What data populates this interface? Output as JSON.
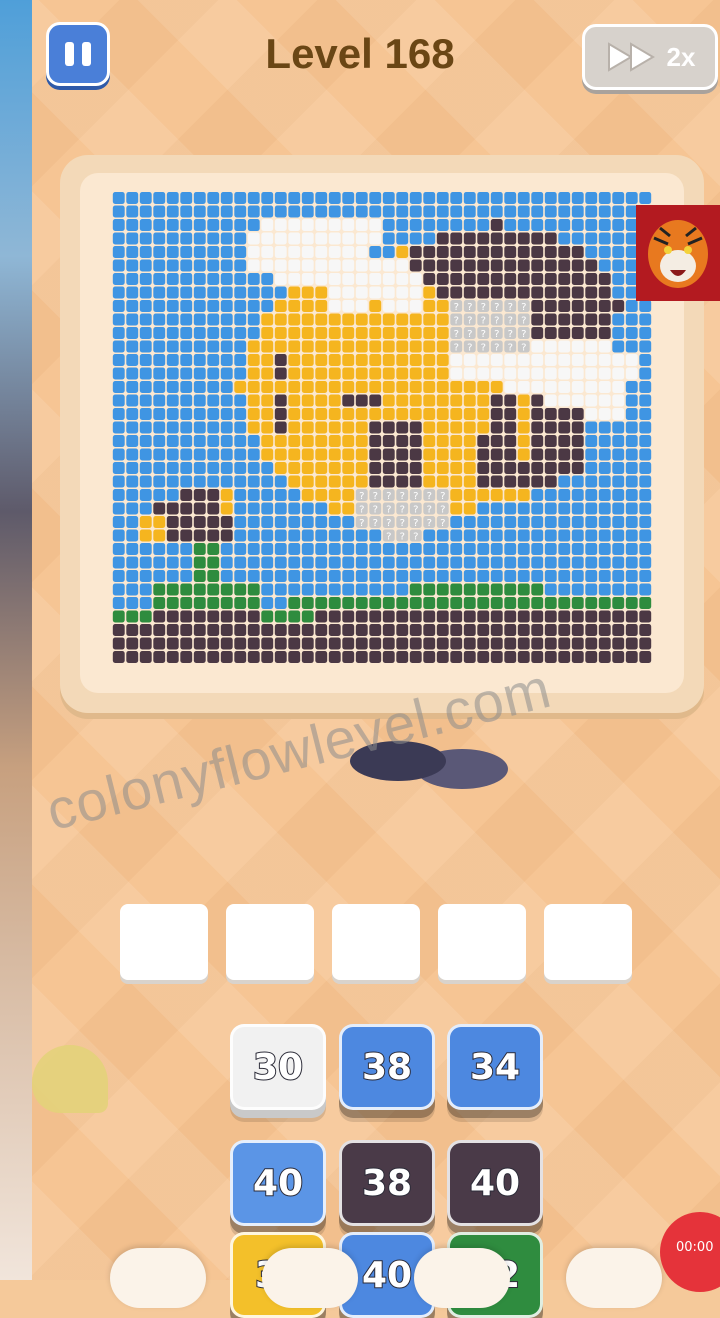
{
  "header": {
    "level_title": "Level 168",
    "speed_label": "2x"
  },
  "watermark": "colonyflowlevel.com",
  "recorder_time": "00:00",
  "colors": {
    "sky": "#3f95e3",
    "yellow": "#f5b51f",
    "dark": "#4b3844",
    "white": "#f7f7f7",
    "green": "#2e8c3e",
    "hidden": "#c8c8c8"
  },
  "slots": [
    {
      "id": 1
    },
    {
      "id": 2
    },
    {
      "id": 3
    },
    {
      "id": 4
    },
    {
      "id": 5
    }
  ],
  "tiles": [
    {
      "label": "30",
      "color": "#f1f1f1"
    },
    {
      "label": "38",
      "color": "#4d88e0"
    },
    {
      "label": "34",
      "color": "#4d88e0"
    },
    {
      "label": "40",
      "color": "#5b95e6"
    },
    {
      "label": "38",
      "color": "#4a3a48"
    },
    {
      "label": "40",
      "color": "#4a3a48"
    },
    {
      "label": "3?",
      "color": "#f3c02a"
    },
    {
      "label": "40",
      "color": "#4d88e0"
    },
    {
      "label": "12",
      "color": "#2f8c3f"
    }
  ]
}
